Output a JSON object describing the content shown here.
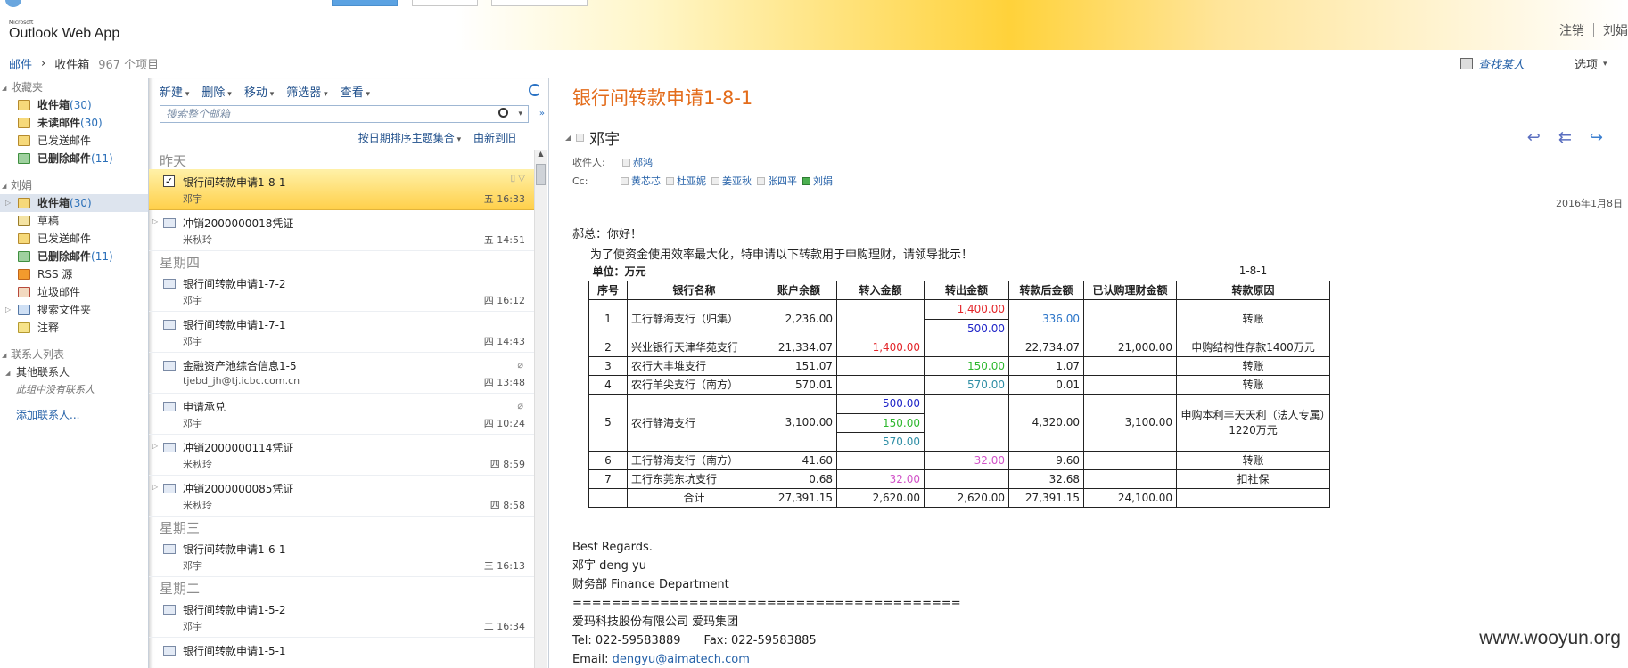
{
  "brand": {
    "ms": "Microsoft",
    "app": "Outlook Web App"
  },
  "top_right": {
    "signout": "注销",
    "user": "刘娟"
  },
  "breadcrumb": {
    "mail": "邮件",
    "sep": "›",
    "folder": "收件箱",
    "count": "967 个项目"
  },
  "header_right": {
    "find_people": "查找某人",
    "options": "选项"
  },
  "nav": {
    "favorites_title": "收藏夹",
    "favorites": [
      {
        "label": "收件箱",
        "count": "(30)",
        "bold": true,
        "icon": "inbox-icon"
      },
      {
        "label": "未读邮件",
        "count": "(30)",
        "bold": true,
        "icon": "unread-icon"
      },
      {
        "label": "已发送邮件",
        "count": "",
        "bold": false,
        "icon": "sent-icon"
      },
      {
        "label": "已删除邮件",
        "count": "(11)",
        "bold": true,
        "icon": "trash-icon"
      }
    ],
    "mailbox_title": "刘娟",
    "mailbox": [
      {
        "label": "收件箱",
        "count": "(30)",
        "bold": true,
        "icon": "inbox-icon"
      },
      {
        "label": "草稿",
        "count": "",
        "bold": false,
        "icon": "draft-icon"
      },
      {
        "label": "已发送邮件",
        "count": "",
        "bold": false,
        "icon": "sent-icon"
      },
      {
        "label": "已删除邮件",
        "count": "(11)",
        "bold": true,
        "icon": "trash-icon"
      },
      {
        "label": "RSS 源",
        "count": "",
        "bold": false,
        "icon": "rss-icon"
      },
      {
        "label": "垃圾邮件",
        "count": "",
        "bold": false,
        "icon": "junk-icon"
      },
      {
        "label": "搜索文件夹",
        "count": "",
        "bold": false,
        "icon": "search-folder-icon"
      },
      {
        "label": "注释",
        "count": "",
        "bold": false,
        "icon": "notes-icon"
      }
    ],
    "contacts_title": "联系人列表",
    "other_contacts": "其他联系人",
    "no_contacts": "此组中没有联系人",
    "add_contact": "添加联系人..."
  },
  "toolbar": {
    "new": "新建",
    "delete": "删除",
    "move": "移动",
    "filter": "筛选器",
    "view": "查看"
  },
  "search": {
    "placeholder": "搜索整个邮箱"
  },
  "sort": {
    "by": "按日期排序主题集合",
    "order": "由新到旧"
  },
  "groups": [
    {
      "label": "昨天",
      "messages": [
        {
          "subject": "银行间转款申请1-8-1",
          "from": "邓宇",
          "time": "五 16:33",
          "selected": true
        },
        {
          "subject": "冲销2000000018凭证",
          "from": "米秋玲",
          "time": "五 14:51",
          "thread": true
        }
      ]
    },
    {
      "label": "星期四",
      "messages": [
        {
          "subject": "银行间转款申请1-7-2",
          "from": "邓宇",
          "time": "四 16:12"
        },
        {
          "subject": "银行间转款申请1-7-1",
          "from": "邓宇",
          "time": "四 14:43"
        },
        {
          "subject": "金融资产池综合信息1-5",
          "from": "tjebd_jh@tj.icbc.com.cn",
          "time": "四 13:48",
          "attach": true
        },
        {
          "subject": "申请承兑",
          "from": "邓宇",
          "time": "四 10:24",
          "attach": true
        },
        {
          "subject": "冲销2000000114凭证",
          "from": "米秋玲",
          "time": "四 8:59",
          "thread": true
        },
        {
          "subject": "冲销2000000085凭证",
          "from": "米秋玲",
          "time": "四 8:58",
          "thread": true
        }
      ]
    },
    {
      "label": "星期三",
      "messages": [
        {
          "subject": "银行间转款申请1-6-1",
          "from": "邓宇",
          "time": "三 16:13"
        }
      ]
    },
    {
      "label": "星期二",
      "messages": [
        {
          "subject": "银行间转款申请1-5-2",
          "from": "邓宇",
          "time": "二 16:34"
        },
        {
          "subject": "银行间转款申请1-5-1",
          "from": "",
          "time": ""
        }
      ]
    }
  ],
  "reading": {
    "title": "银行间转款申请1-8-1",
    "sender": "邓宇",
    "to_label": "收件人:",
    "to": [
      "郝鸿"
    ],
    "cc_label": "Cc:",
    "cc": [
      "黄芯芯",
      "杜亚妮",
      "姜亚秋",
      "张四平",
      "刘娟"
    ],
    "date": "2016年1月8日",
    "greeting": "郝总：你好！",
    "intro": "为了使资金使用效率最大化，特申请以下转款用于申购理财，请领导批示！",
    "unit": "单位：万元",
    "code": "1-8-1",
    "headers": [
      "序号",
      "银行名称",
      "账户余额",
      "转入金额",
      "转出金额",
      "转款后金额",
      "已认购理财金额",
      "转款原因"
    ],
    "rows": [
      {
        "no": "1",
        "bank": "工行静海支行（归集）",
        "balance": "2,236.00",
        "in": "",
        "out": [
          "1,400.00",
          "500.00"
        ],
        "after": "336.00",
        "wealth": "",
        "reason": "转账"
      },
      {
        "no": "2",
        "bank": "兴业银行天津华苑支行",
        "balance": "21,334.07",
        "in": "1,400.00",
        "out": "",
        "after": "22,734.07",
        "wealth": "21,000.00",
        "reason": "申购结构性存款1400万元"
      },
      {
        "no": "3",
        "bank": "农行大丰堆支行",
        "balance": "151.07",
        "in": "",
        "out": "150.00",
        "after": "1.07",
        "wealth": "",
        "reason": "转账"
      },
      {
        "no": "4",
        "bank": "农行羊尖支行（南方）",
        "balance": "570.01",
        "in": "",
        "out": "570.00",
        "after": "0.01",
        "wealth": "",
        "reason": "转账"
      },
      {
        "no": "5",
        "bank": "农行静海支行",
        "balance": "3,100.00",
        "in": [
          "500.00",
          "150.00",
          "570.00"
        ],
        "out": "",
        "after": "4,320.00",
        "wealth": "3,100.00",
        "reason": "申购本利丰天天利（法人专属）1220万元"
      },
      {
        "no": "6",
        "bank": "工行静海支行（南方）",
        "balance": "41.60",
        "in": "",
        "out": "32.00",
        "after": "9.60",
        "wealth": "",
        "reason": "转账"
      },
      {
        "no": "7",
        "bank": "工行东莞东坑支行",
        "balance": "0.68",
        "in": "32.00",
        "out": "",
        "after": "32.68",
        "wealth": "",
        "reason": "扣社保"
      }
    ],
    "total": {
      "label": "合计",
      "balance": "27,391.15",
      "in": "2,620.00",
      "out": "2,620.00",
      "after": "27,391.15",
      "wealth": "24,100.00"
    },
    "sig": {
      "regards": "Best Regards.",
      "name": "邓宇  deng yu",
      "dept": "财务部  Finance Department",
      "rule": "========================================",
      "company": "爱玛科技股份有限公司    爱玛集团",
      "tel": "Tel:   022-59583889",
      "fax": "Fax:  022-59583885",
      "email_label": "Email:  ",
      "email": "dengyu@aimatech.com"
    }
  },
  "watermark": "www.wooyun.org"
}
